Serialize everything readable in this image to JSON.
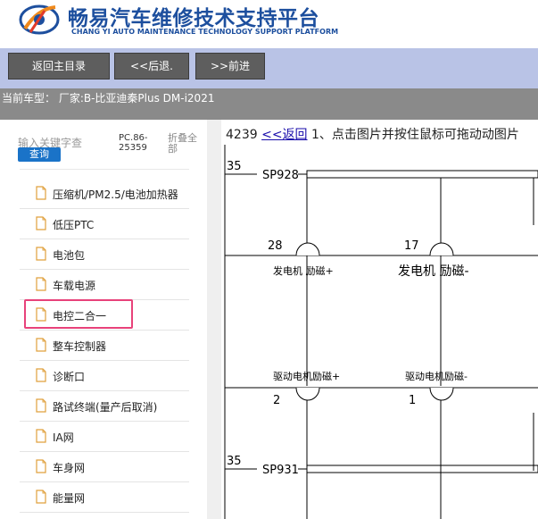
{
  "header": {
    "title": "畅易汽车维修技术支持平台",
    "subtitle": "CHANG YI AUTO MAINTENANCE TECHNOLOGY SUPPORT PLATFORM",
    "brand_color": "#1d4f9e"
  },
  "toolbar": {
    "home_label": "返回主目录",
    "back_label": "<<后退.",
    "forward_label": ">>前进"
  },
  "vehicle": {
    "text": "当前车型： 厂家:B-比亚迪秦Plus DM-i2021"
  },
  "sidebar": {
    "search_placeholder": "输入关键字查",
    "search_button": "查询",
    "pc_code": "PC.86-25359",
    "collapse_all": "折叠全部",
    "items": [
      {
        "label": "压缩机/PM2.5/电池加热器"
      },
      {
        "label": "低压PTC"
      },
      {
        "label": "电池包"
      },
      {
        "label": "车载电源"
      },
      {
        "label": "电控二合一"
      },
      {
        "label": "整车控制器"
      },
      {
        "label": "诊断口"
      },
      {
        "label": "路试终端(量产后取消)"
      },
      {
        "label": "IA网"
      },
      {
        "label": "车身网"
      },
      {
        "label": "能量网"
      }
    ],
    "highlight_color": "#e8427a"
  },
  "main": {
    "id_text": "4239",
    "back_link": "<<返回",
    "instruction": "1、点击图片并按住鼠标可拖动动图片"
  },
  "diagram": {
    "labels": {
      "pin_35_top": "35",
      "sp928": "SP928",
      "pin_28": "28",
      "pin_17": "17",
      "gen_excite_pos": "发电机 励磁+",
      "gen_excite_neg": "发电机 励磁-",
      "drive_excite_pos": "驱动电机励磁+",
      "drive_excite_neg": "驱动电机励磁-",
      "pin_2": "2",
      "pin_1": "1",
      "pin_35_bottom": "35",
      "sp931": "SP931"
    }
  }
}
